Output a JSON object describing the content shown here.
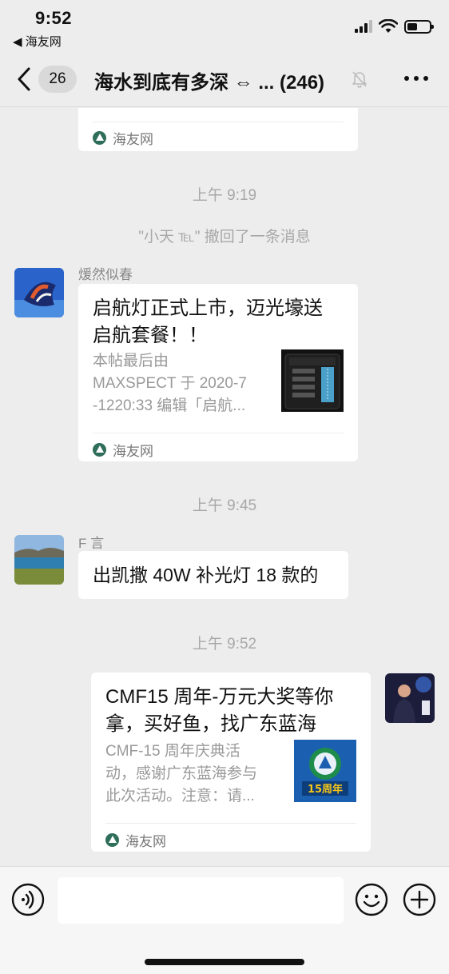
{
  "status": {
    "time": "9:52",
    "back_app": "◀ 海友网"
  },
  "nav": {
    "unread_count": "26",
    "title": "海水到底有多深 ⇔ ...",
    "member_count": "(246)"
  },
  "messages": {
    "top_card": {
      "source": "海友网"
    },
    "ts1": "上午 9:19",
    "recall": "\"小天 ℡\" 撤回了一条消息",
    "m1": {
      "sender": "煖然似春",
      "title_line1": "启航灯正式上市，迈光壕送",
      "title_line2": "启航套餐！！",
      "desc_line1": "本帖最后由",
      "desc_line2": "MAXSPECT 于 2020-7",
      "desc_line3": "-1220:33 编辑「启航...",
      "source": "海友网"
    },
    "ts2": "上午 9:45",
    "m2": {
      "sender": "F 言",
      "text": "出凯撒 40W 补光灯 18 款的"
    },
    "ts3": "上午 9:52",
    "m3": {
      "title_line1": "CMF15 周年-万元大奖等你",
      "title_line2": "拿，买好鱼，找广东蓝海",
      "desc_line1": "CMF-15 周年庆典活",
      "desc_line2": "动，感谢广东蓝海参与",
      "desc_line3": "此次活动。注意：请...",
      "thumb_label": "15周年",
      "source": "海友网"
    }
  },
  "input": {
    "placeholder": ""
  },
  "colors": {
    "background": "#ededed",
    "bubble": "#ffffff",
    "meta_text": "#a8a8a8",
    "source_logo": "#2f6e5a"
  }
}
